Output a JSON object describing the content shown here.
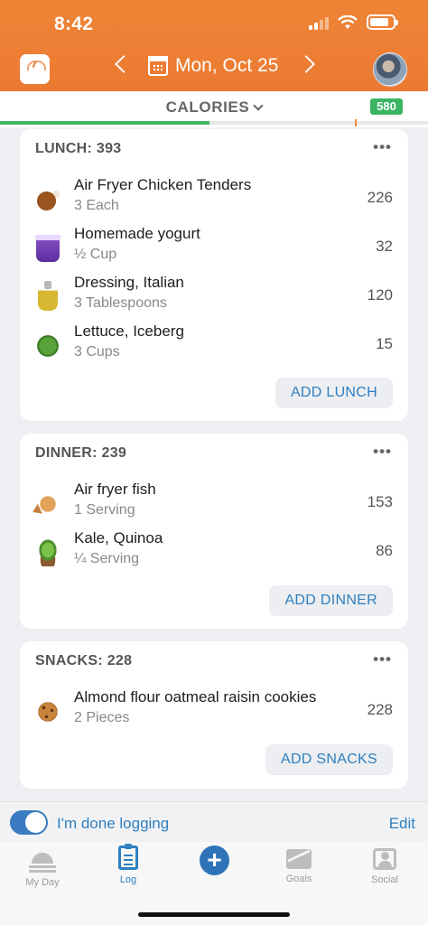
{
  "status_bar": {
    "time": "8:42",
    "battery_level": 0.85
  },
  "header": {
    "date": "Mon, Oct 25",
    "icons": {
      "left": "scale-icon",
      "prev": "chevron-left-icon",
      "calendar": "calendar-icon",
      "next": "chevron-right-icon",
      "profile": "avatar"
    },
    "background_color": "#ec7a32"
  },
  "calorie_bar": {
    "title": "CALORIES",
    "remaining_badge": "580",
    "progress_fraction": 0.49,
    "progress_color": "#3fb55e",
    "badge_color": "#3bb463"
  },
  "meals": [
    {
      "title": "LUNCH: 393",
      "more": "•••",
      "add_label": "ADD LUNCH",
      "items": [
        {
          "name": "Air Fryer Chicken Tenders",
          "amount": "3 Each",
          "calories": "226",
          "icon": "chicken-icon"
        },
        {
          "name": "Homemade yogurt",
          "amount": "½ Cup",
          "calories": "32",
          "icon": "yogurt-icon"
        },
        {
          "name": "Dressing, Italian",
          "amount": "3 Tablespoons",
          "calories": "120",
          "icon": "oil-bottle-icon"
        },
        {
          "name": "Lettuce, Iceberg",
          "amount": "3 Cups",
          "calories": "15",
          "icon": "lettuce-icon"
        }
      ]
    },
    {
      "title": "DINNER: 239",
      "more": "•••",
      "add_label": "ADD DINNER",
      "items": [
        {
          "name": "Air fryer fish",
          "amount": "1 Serving",
          "calories": "153",
          "icon": "fish-icon"
        },
        {
          "name": "Kale, Quinoa",
          "amount": "¼ Serving",
          "calories": "86",
          "icon": "salad-icon"
        }
      ]
    },
    {
      "title": "SNACKS: 228",
      "more": "•••",
      "add_label": "ADD SNACKS",
      "items": [
        {
          "name": "Almond flour oatmeal raisin cookies",
          "amount": "2 Pieces",
          "calories": "228",
          "icon": "cookie-icon"
        }
      ]
    }
  ],
  "done_logging": {
    "label": "I'm done logging",
    "enabled": true,
    "edit_label": "Edit"
  },
  "tabbar": {
    "tabs": [
      {
        "label": "My Day",
        "icon": "sunrise-icon"
      },
      {
        "label": "Log",
        "icon": "clipboard-icon",
        "active": true
      },
      {
        "label": "",
        "icon": "plus-icon"
      },
      {
        "label": "Goals",
        "icon": "goals-icon"
      },
      {
        "label": "Social",
        "icon": "social-icon"
      }
    ],
    "accent_color": "#2e7fc0"
  }
}
